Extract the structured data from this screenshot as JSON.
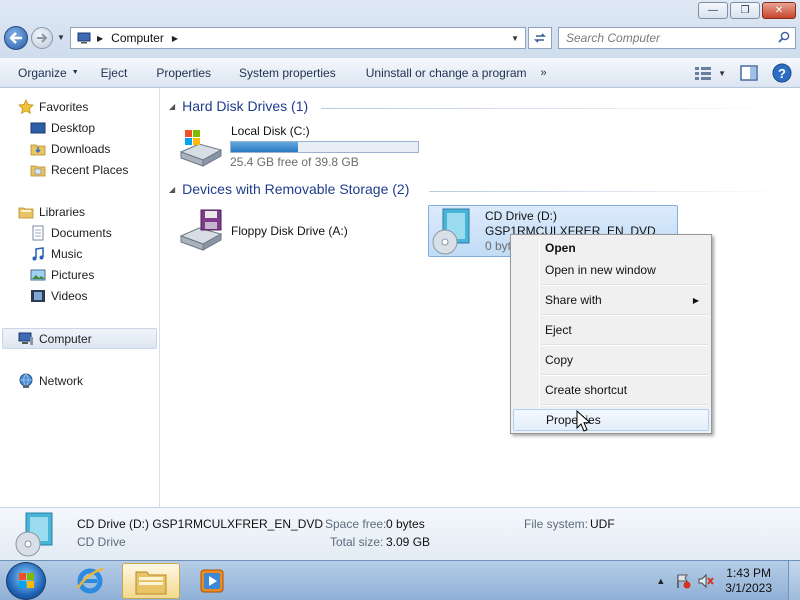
{
  "window": {
    "minimize_glyph": "—",
    "maximize_glyph": "❐",
    "close_glyph": "✕"
  },
  "address": {
    "path": [
      "Computer"
    ],
    "search_placeholder": "Search Computer"
  },
  "toolbar": {
    "organize": "Organize",
    "eject": "Eject",
    "properties": "Properties",
    "system_properties": "System properties",
    "uninstall": "Uninstall or change a program",
    "more": "»"
  },
  "sidebar": {
    "favorites": "Favorites",
    "desktop": "Desktop",
    "downloads": "Downloads",
    "recent_places": "Recent Places",
    "libraries": "Libraries",
    "documents": "Documents",
    "music": "Music",
    "pictures": "Pictures",
    "videos": "Videos",
    "computer": "Computer",
    "network": "Network"
  },
  "groups": {
    "hard_disks": "Hard Disk Drives (1)",
    "removable": "Devices with Removable Storage (2)"
  },
  "drives": {
    "local": {
      "name": "Local Disk (C:)",
      "free_text": "25.4 GB free of 39.8 GB",
      "used_fraction": 0.36
    },
    "floppy": {
      "name": "Floppy Disk Drive (A:)"
    },
    "cd": {
      "line1": "CD Drive (D:)",
      "line2": "GSP1RMCULXFRER_EN_DVD",
      "line3": "0 bytes free of 3.09 GB"
    }
  },
  "context_menu": {
    "open": "Open",
    "open_new_window": "Open in new window",
    "share_with": "Share with",
    "eject": "Eject",
    "copy": "Copy",
    "create_shortcut": "Create shortcut",
    "properties": "Properties"
  },
  "details": {
    "title": "CD Drive (D:) GSP1RMCULXFRER_EN_DVD",
    "subtitle": "CD Drive",
    "space_free_label": "Space free:",
    "space_free": "0 bytes",
    "total_size_label": "Total size:",
    "total_size": "3.09 GB",
    "file_system_label": "File system:",
    "file_system": "UDF"
  },
  "taskbar": {
    "time": "1:43 PM",
    "date": "3/1/2023"
  },
  "colors": {
    "accent": "#1e3d8a",
    "selection": "#c1dcf6",
    "usage_bar": "#2a7bc2"
  }
}
